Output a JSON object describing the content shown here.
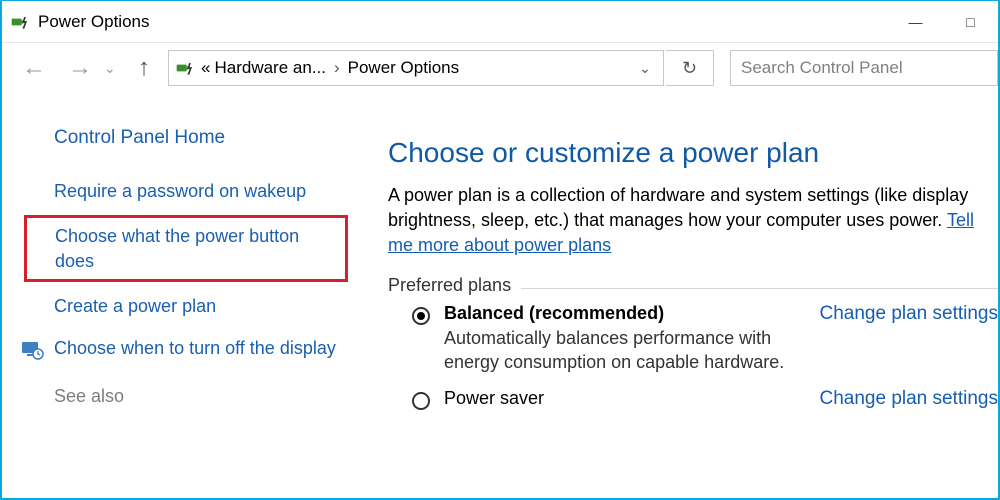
{
  "window": {
    "title": "Power Options",
    "minimize": "—",
    "maximize": "□"
  },
  "nav": {
    "back": "←",
    "forward": "→",
    "recent": "⌄",
    "up": "↑",
    "breadcrumb_prefix": "«",
    "crumb1": "Hardware an...",
    "crumb_sep": "›",
    "crumb2": "Power Options",
    "dropdown": "⌄",
    "refresh": "↻",
    "search_placeholder": "Search Control Panel"
  },
  "sidebar": {
    "home": "Control Panel Home",
    "items": [
      {
        "label": "Require a password on wakeup",
        "highlight": false
      },
      {
        "label": "Choose what the power button does",
        "highlight": true
      },
      {
        "label": "Create a power plan",
        "highlight": false
      },
      {
        "label": "Choose when to turn off the display",
        "highlight": false,
        "icon": "monitor"
      }
    ],
    "see_also": "See also"
  },
  "main": {
    "heading": "Choose or customize a power plan",
    "description_pre": "A power plan is a collection of hardware and system settings (like display brightness, sleep, etc.) that manages how your computer uses power. ",
    "description_link": "Tell me more about power plans",
    "preferred_label": "Preferred plans",
    "plans": [
      {
        "name": "Balanced (recommended)",
        "desc": "Automatically balances performance with energy consumption on capable hardware.",
        "checked": true,
        "change": "Change plan settings"
      },
      {
        "name": "Power saver",
        "desc": "",
        "checked": false,
        "change": "Change plan settings"
      }
    ]
  }
}
